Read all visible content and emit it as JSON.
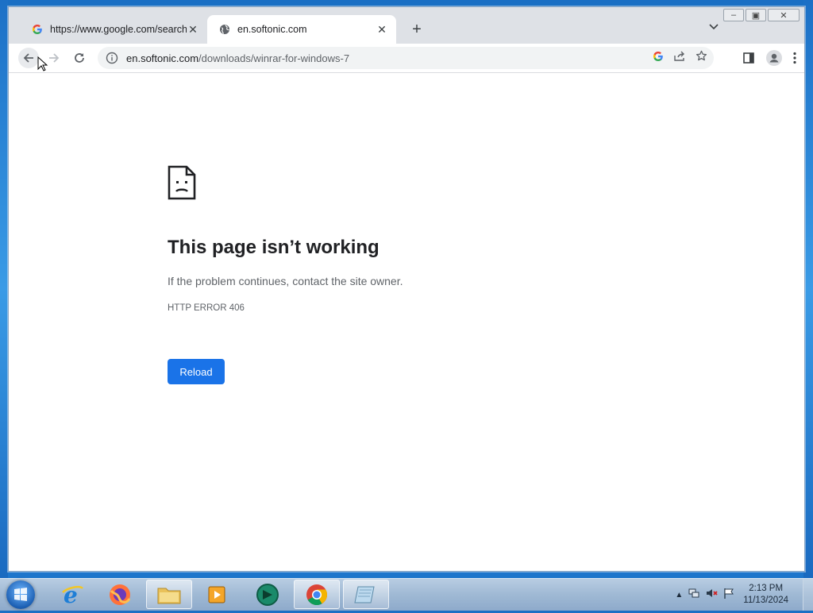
{
  "browser": {
    "tabs": [
      {
        "title": "https://www.google.com/search",
        "favicon": "google-g-icon",
        "active": false
      },
      {
        "title": "en.softonic.com",
        "favicon": "globe-icon",
        "active": true
      }
    ],
    "address": {
      "host": "en.softonic.com",
      "path": "/downloads/winrar-for-windows-7"
    }
  },
  "error_page": {
    "heading": "This page isn’t working",
    "message": "If the problem continues, contact the site owner.",
    "code": "HTTP ERROR 406",
    "reload_label": "Reload"
  },
  "taskbar": {
    "apps": [
      "internet-explorer",
      "firefox",
      "file-explorer",
      "media-player",
      "unknown-app",
      "chrome",
      "notepad"
    ],
    "clock": {
      "time": "2:13 PM",
      "date": "11/13/2024"
    }
  },
  "colors": {
    "accent": "#1a73e8",
    "tabstrip": "#dee1e6",
    "desktop": "#1d73c9"
  }
}
